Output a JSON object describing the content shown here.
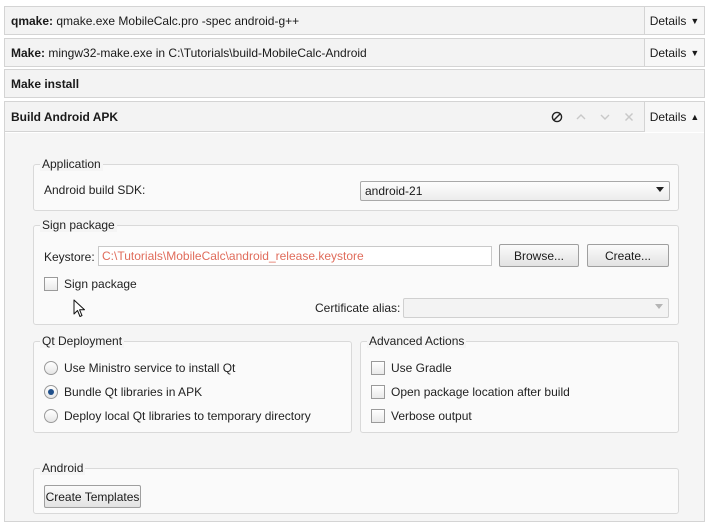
{
  "steps": [
    {
      "bold": "qmake:",
      "text": " qmake.exe MobileCalc.pro -spec android-g++",
      "details": "Details"
    },
    {
      "bold": "Make:",
      "text": " mingw32-make.exe in C:\\Tutorials\\build-MobileCalc-Android",
      "details": "Details"
    },
    {
      "bold": "Make install",
      "text": ""
    }
  ],
  "apk_step": {
    "title": "Build Android APK",
    "details": "Details"
  },
  "application": {
    "group_title": "Application",
    "sdk_label": "Android build SDK:",
    "sdk_value": "android-21"
  },
  "sign": {
    "group_title": "Sign package",
    "keystore_label": "Keystore:",
    "keystore_value": "C:\\Tutorials\\MobileCalc\\android_release.keystore",
    "browse_label": "Browse...",
    "create_label": "Create...",
    "sign_checkbox_label": "Sign package",
    "cert_alias_label": "Certificate alias:",
    "cert_alias_value": ""
  },
  "qt_deployment": {
    "group_title": "Qt Deployment",
    "options": [
      "Use Ministro service to install Qt",
      "Bundle Qt libraries in APK",
      "Deploy local Qt libraries to temporary directory"
    ],
    "selected_index": 1
  },
  "advanced": {
    "group_title": "Advanced Actions",
    "options": [
      "Use Gradle",
      "Open package location after build",
      "Verbose output"
    ]
  },
  "android": {
    "group_title": "Android",
    "create_templates_label": "Create Templates"
  },
  "icons": {
    "disable": "disable-icon",
    "move_up": "chevron-up-icon",
    "move_down": "chevron-down-icon",
    "remove": "close-icon",
    "details_collapsed": "caret-down-icon",
    "details_expanded": "caret-up-icon"
  },
  "colors": {
    "keystore_text": "#e06c5b",
    "radio_dot": "#1f4f8a"
  }
}
